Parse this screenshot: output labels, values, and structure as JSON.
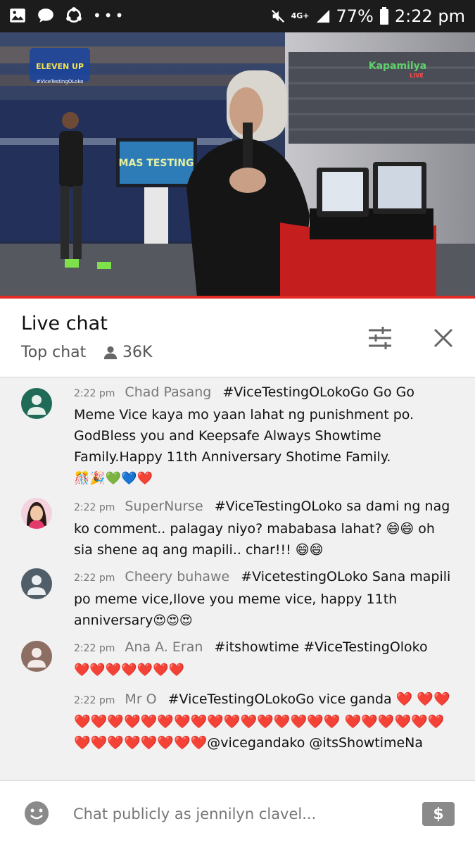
{
  "status_bar": {
    "network": "4G+",
    "battery": "77%",
    "time": "2:22 pm",
    "dots": "•••"
  },
  "video": {
    "channel_logo": "Kapamilya",
    "show_logo": "ELEVEN UP",
    "hashtag_overlay": "#ViceTestingOLoko",
    "screen_text": "MAS TESTING",
    "live_badge": "LIVE"
  },
  "header": {
    "title": "Live chat",
    "mode": "Top chat",
    "viewers": "36K"
  },
  "messages": [
    {
      "time": "2:22 pm",
      "author": "Chad Pasang",
      "text": "#ViceTestingOLokoGo Go Go Meme Vice kaya mo yaan lahat ng punishment po. GodBless you and Keepsafe Always Showtime Family.Happy 11th Anniversary Shotime Family.",
      "emoji": "🎊🎉💚💙❤️",
      "avatar_color": "#1f6b57"
    },
    {
      "time": "2:22 pm",
      "author": "SuperNurse",
      "text": "#ViceTestingOLoko sa dami ng nag ko comment.. palagay niyo? mababasa lahat? 😄😄 oh sia shene aq ang mapili.. char!!! 😄😄",
      "emoji": "",
      "avatar_color": "#f2c9d6"
    },
    {
      "time": "2:22 pm",
      "author": "Cheery buhawe",
      "text": "#VicetestingOLoko Sana mapili po meme vice,Ilove you meme vice, happy 11th anniversary",
      "emoji": "😍😍😍",
      "avatar_color": "#4f5e69"
    },
    {
      "time": "2:22 pm",
      "author": "Ana A. Eran",
      "text": "#itshowtime #ViceTestingOloko",
      "emoji": "❤️❤️❤️❤️❤️❤️❤️",
      "avatar_color": "#8d6e63"
    },
    {
      "time": "2:22 pm",
      "author": "Mr O",
      "text": "#ViceTestingOLokoGo vice ganda ❤️ ❤️❤️❤️❤️❤️❤️❤️❤️❤️❤️❤️❤️❤️❤️❤️❤️❤️❤️ ❤️❤️❤️❤️❤️❤️❤️❤️❤️❤️❤️❤️❤️❤️@vicegandako @itsShowtimeNa",
      "emoji": "",
      "avatar_color": ""
    }
  ],
  "input": {
    "placeholder": "Chat publicly as jennilyn clavel...",
    "superchat_icon": "$"
  },
  "colors": {
    "progress": "#e52d27",
    "header_bg": "#ffffff",
    "chat_bg": "#f1f1f1"
  }
}
